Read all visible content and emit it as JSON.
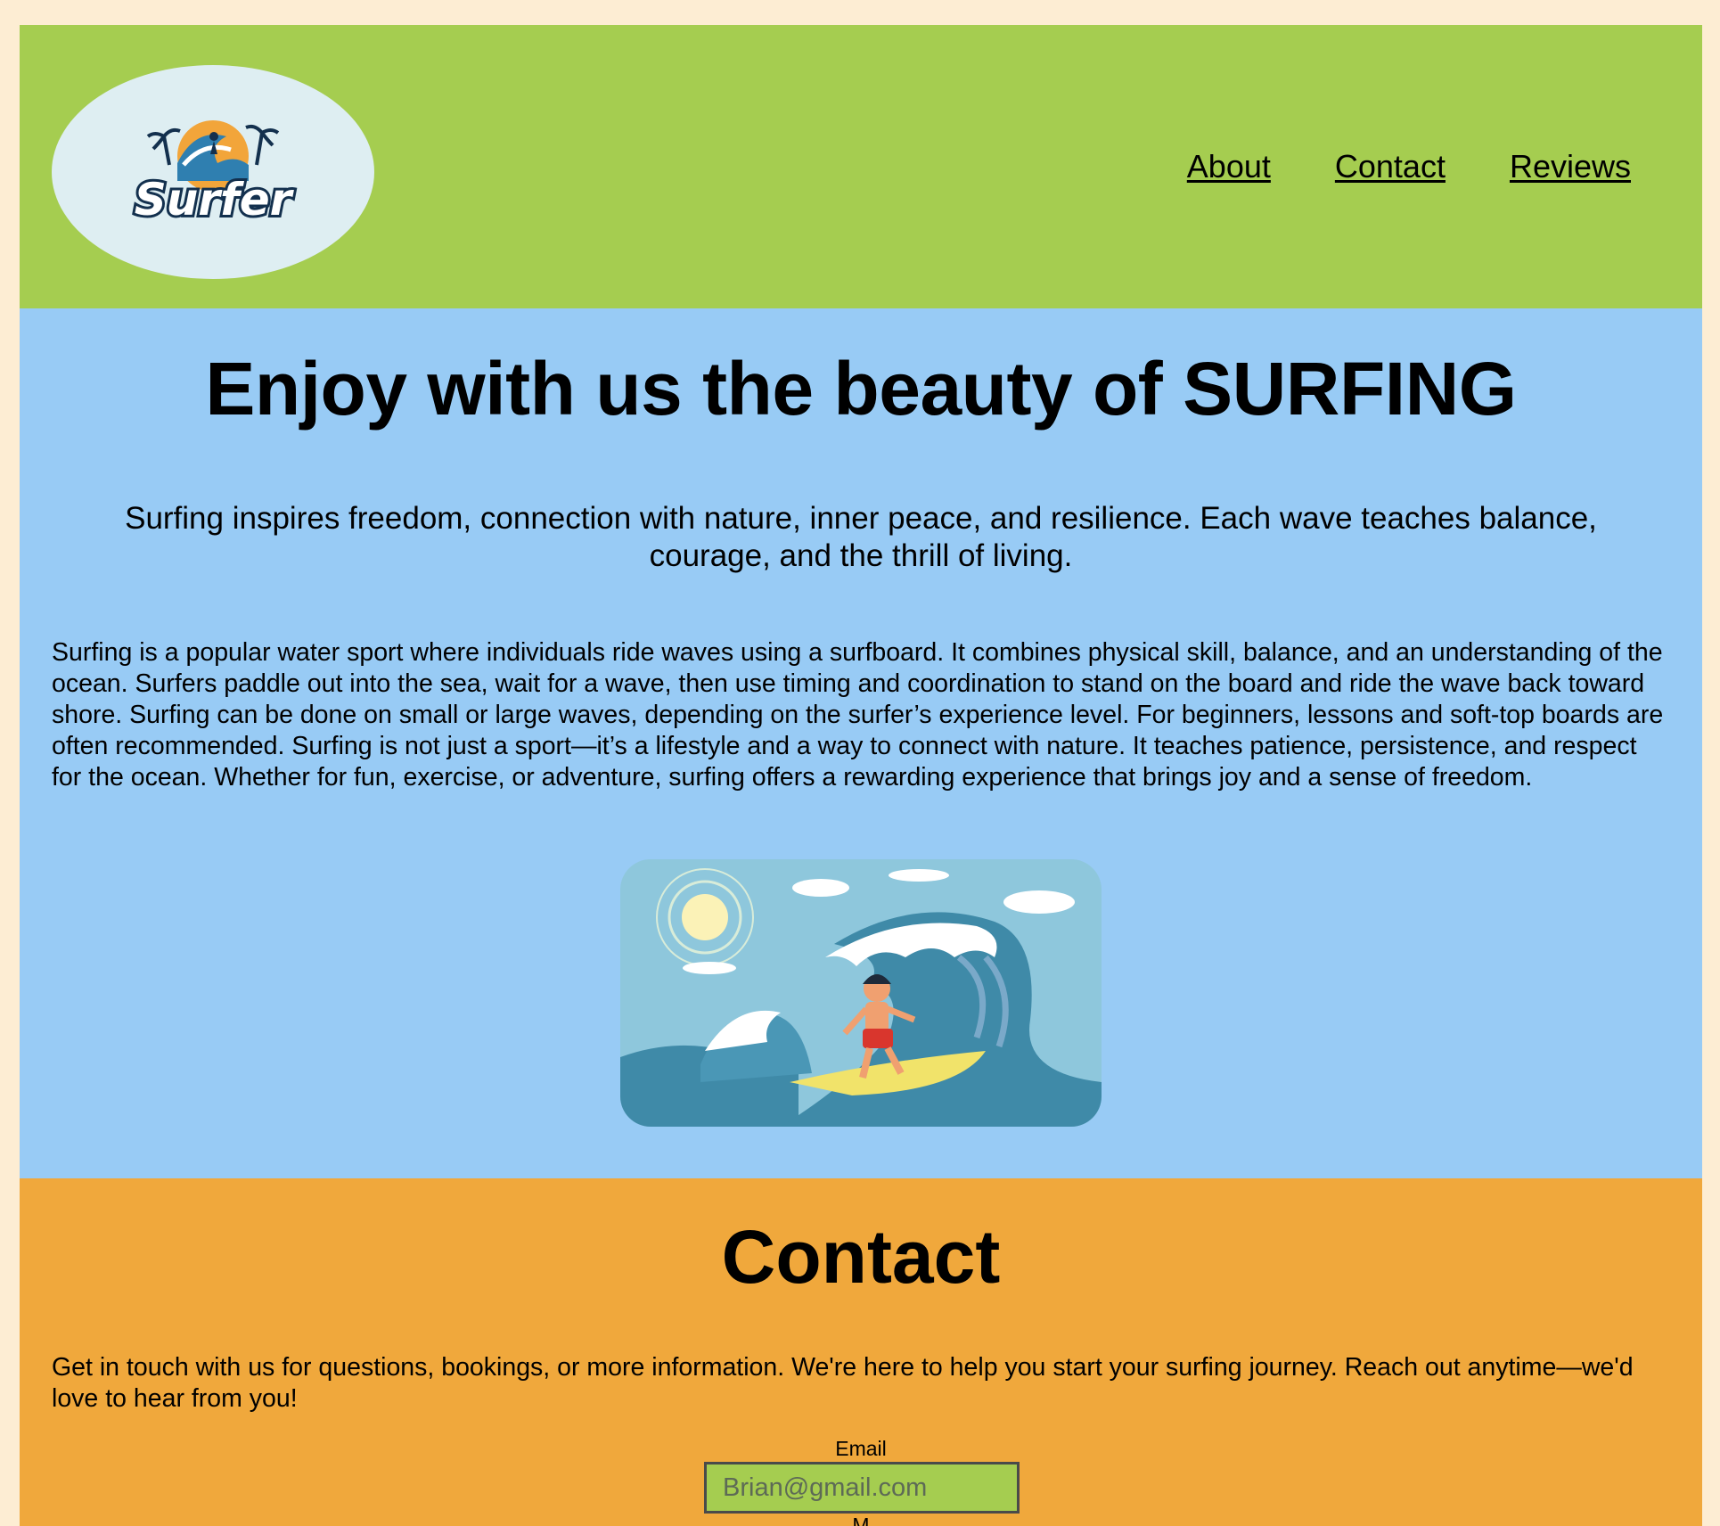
{
  "header": {
    "logo_text": "Surfer",
    "nav": [
      {
        "label": "About"
      },
      {
        "label": "Contact"
      },
      {
        "label": "Reviews"
      }
    ]
  },
  "hero": {
    "title": "Enjoy with us the beauty of SURFING",
    "tagline": "Surfing inspires freedom, connection with nature, inner peace, and resilience. Each wave teaches balance, courage, and the thrill of living.",
    "body": "Surfing is a popular water sport where individuals ride waves using a surfboard. It combines physical skill, balance, and an understanding of the ocean. Surfers paddle out into the sea, wait for a wave, then use timing and coordination to stand on the board and ride the wave back toward shore. Surfing can be done on small or large waves, depending on the surfer’s experience level. For beginners, lessons and soft-top boards are often recommended. Surfing is not just a sport—it’s a lifestyle and a way to connect with nature. It teaches patience, persistence, and respect for the ocean. Whether for fun, exercise, or adventure, surfing offers a rewarding experience that brings joy and a sense of freedom."
  },
  "contact": {
    "title": "Contact",
    "text": "Get in touch with us for questions, bookings, or more information. We're here to help you start your surfing journey. Reach out anytime—we'd love to hear from you!",
    "email_label": "Email",
    "email_placeholder": "Brian@gmail.com",
    "next_label": "M"
  },
  "colors": {
    "page_bg": "#fdedd3",
    "header_bg": "#a5cd50",
    "hero_bg": "#98cbf5",
    "contact_bg": "#f0a83c",
    "logo_bg": "#deeef2"
  }
}
